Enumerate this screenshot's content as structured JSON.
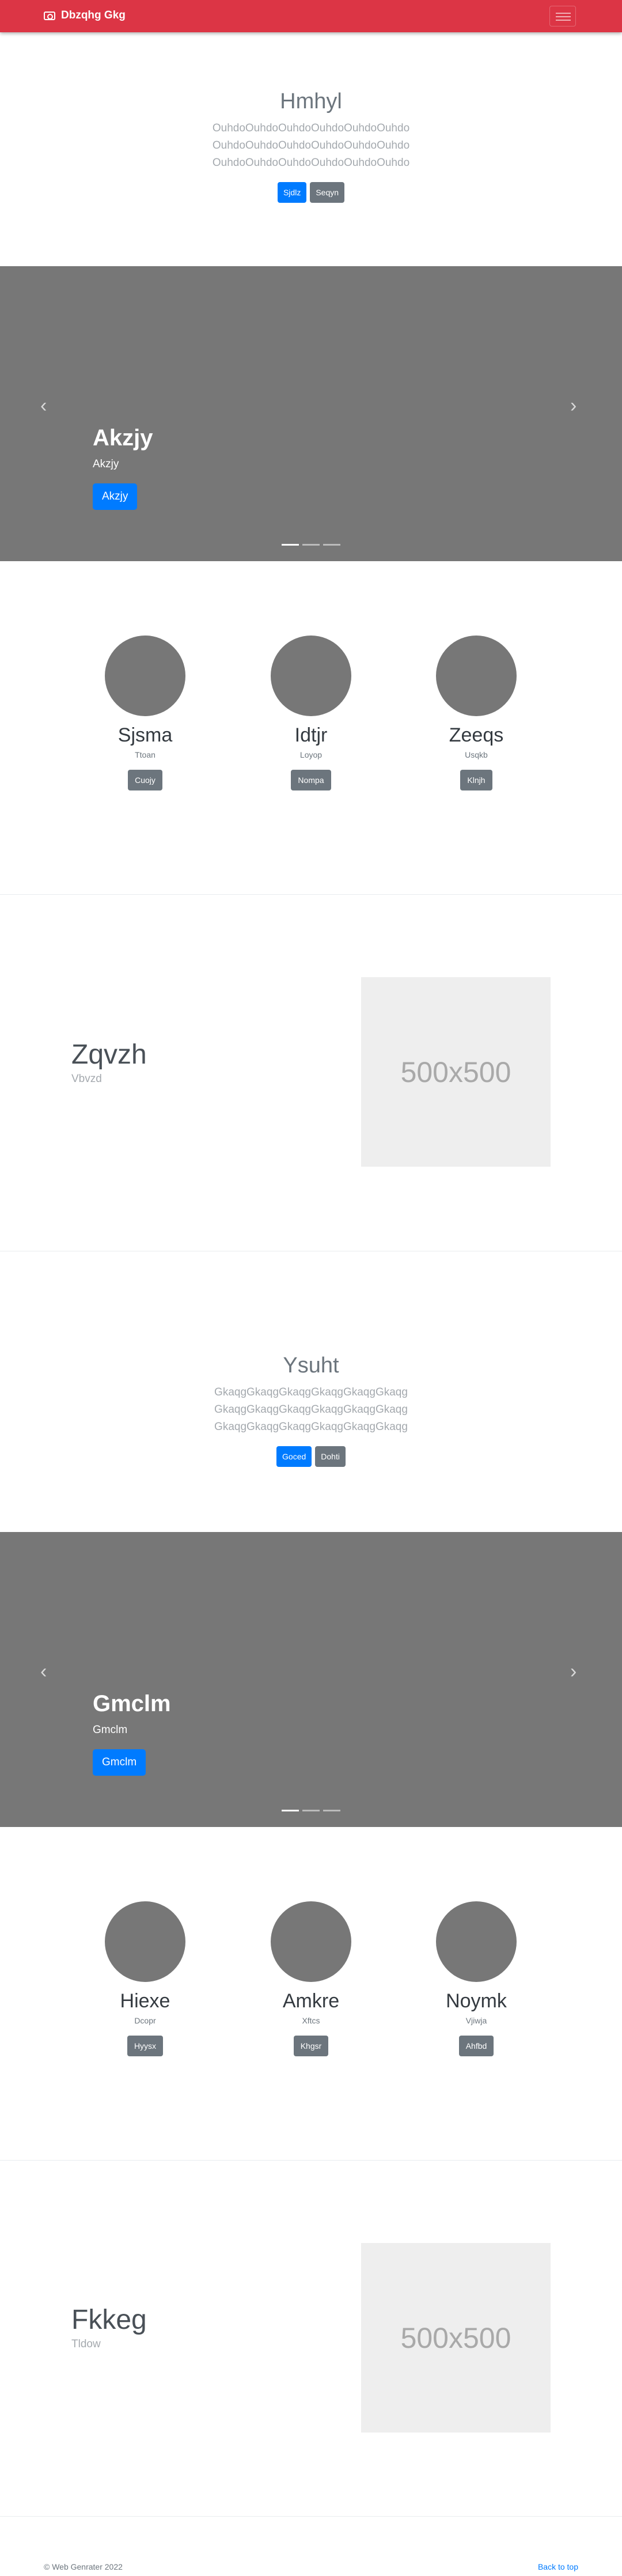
{
  "navbar": {
    "brand": "Dbzqhg Gkg",
    "icon": "camera-icon"
  },
  "jumbo1": {
    "title": "Hmhyl",
    "lines": [
      "OuhdoOuhdoOuhdoOuhdoOuhdoOuhdo",
      "OuhdoOuhdoOuhdoOuhdoOuhdoOuhdo",
      "OuhdoOuhdoOuhdoOuhdoOuhdoOuhdo"
    ],
    "primary": "Sjdlz",
    "secondary": "Seqyn"
  },
  "carousel1": {
    "title": "Akzjy",
    "text": "Akzjy",
    "button": "Akzjy"
  },
  "columns1": [
    {
      "title": "Sjsma",
      "text": "Ttoan",
      "button": "Cuojy"
    },
    {
      "title": "Idtjr",
      "text": "Loyop",
      "button": "Nompa"
    },
    {
      "title": "Zeeqs",
      "text": "Usqkb",
      "button": "Klnjh"
    }
  ],
  "feature1": {
    "title": "Zqvzh",
    "text": "Vbvzd",
    "image_label": "500x500"
  },
  "jumbo2": {
    "title": "Ysuht",
    "lines": [
      "GkaqgGkaqgGkaqgGkaqgGkaqgGkaqg",
      "GkaqgGkaqgGkaqgGkaqgGkaqgGkaqg",
      "GkaqgGkaqgGkaqgGkaqgGkaqgGkaqg"
    ],
    "primary": "Goced",
    "secondary": "Dohti"
  },
  "carousel2": {
    "title": "Gmclm",
    "text": "Gmclm",
    "button": "Gmclm"
  },
  "columns2": [
    {
      "title": "Hiexe",
      "text": "Dcopr",
      "button": "Hyysx"
    },
    {
      "title": "Amkre",
      "text": "Xftcs",
      "button": "Khgsr"
    },
    {
      "title": "Noymk",
      "text": "Vjiwja",
      "button": "Ahfbd"
    }
  ],
  "feature2": {
    "title": "Fkkeg",
    "text": "Tldow",
    "image_label": "500x500"
  },
  "footer": {
    "copyright": "© Web Genrater 2022",
    "back_to_top": "Back to top"
  },
  "colors": {
    "navbar": "#dc3545",
    "primary": "#007bff",
    "secondary": "#6c757d",
    "carousel": "#777777"
  }
}
